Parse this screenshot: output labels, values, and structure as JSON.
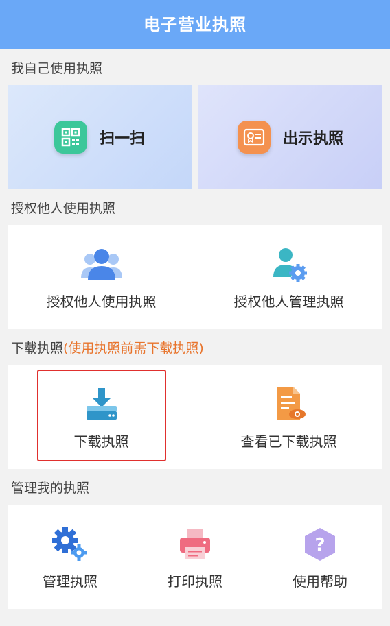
{
  "header": {
    "title": "电子营业执照"
  },
  "sections": {
    "self": {
      "label": "我自己使用执照"
    },
    "authorize": {
      "label": "授权他人使用执照"
    },
    "download": {
      "label": "下载执照",
      "note": "(使用执照前需下载执照)"
    },
    "manage": {
      "label": "管理我的执照"
    }
  },
  "self_actions": [
    {
      "label": "扫一扫",
      "icon": "qr-code-icon",
      "color": "#3cc79a"
    },
    {
      "label": "出示执照",
      "icon": "license-card-icon",
      "color": "#f4914f"
    }
  ],
  "authorize_actions": [
    {
      "label": "授权他人使用执照",
      "icon": "users-icon"
    },
    {
      "label": "授权他人管理执照",
      "icon": "user-gear-icon"
    }
  ],
  "download_actions": [
    {
      "label": "下载执照",
      "icon": "download-icon"
    },
    {
      "label": "查看已下载执照",
      "icon": "document-view-icon"
    }
  ],
  "manage_actions": [
    {
      "label": "管理执照",
      "icon": "gears-icon"
    },
    {
      "label": "打印执照",
      "icon": "printer-icon"
    },
    {
      "label": "使用帮助",
      "icon": "help-icon"
    }
  ],
  "colors": {
    "header": "#6aa8f7",
    "note": "#e8742c",
    "highlight": "#e0302e"
  }
}
